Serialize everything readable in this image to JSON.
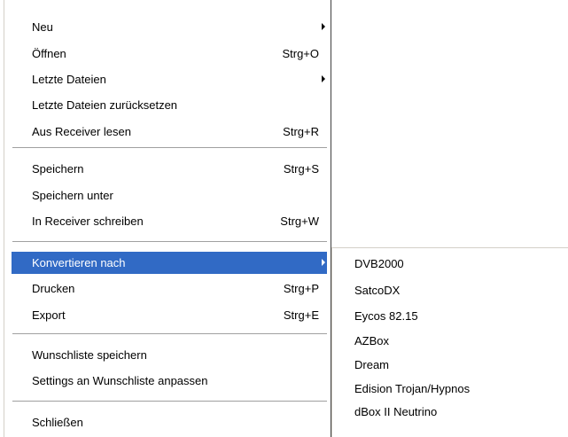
{
  "file_menu": {
    "items": [
      {
        "label": "Neu",
        "shortcut": "",
        "submenu": true
      },
      {
        "label": "Öffnen",
        "shortcut": "Strg+O",
        "submenu": false
      },
      {
        "label": "Letzte Dateien",
        "shortcut": "",
        "submenu": true
      },
      {
        "label": "Letzte Dateien zurücksetzen",
        "shortcut": "",
        "submenu": false
      },
      {
        "label": "Aus Receiver lesen",
        "shortcut": "Strg+R",
        "submenu": false
      },
      {
        "label": "Speichern",
        "shortcut": "Strg+S",
        "submenu": false
      },
      {
        "label": "Speichern unter",
        "shortcut": "",
        "submenu": false
      },
      {
        "label": "In Receiver schreiben",
        "shortcut": "Strg+W",
        "submenu": false
      },
      {
        "label": "Konvertieren nach",
        "shortcut": "",
        "submenu": true,
        "highlighted": true
      },
      {
        "label": "Drucken",
        "shortcut": "Strg+P",
        "submenu": false
      },
      {
        "label": "Export",
        "shortcut": "Strg+E",
        "submenu": false
      },
      {
        "label": "Wunschliste speichern",
        "shortcut": "",
        "submenu": false
      },
      {
        "label": "Settings an Wunschliste anpassen",
        "shortcut": "",
        "submenu": false
      },
      {
        "label": "Schließen",
        "shortcut": "",
        "submenu": false
      }
    ]
  },
  "convert_submenu": {
    "items": [
      {
        "label": "DVB2000"
      },
      {
        "label": "SatcoDX"
      },
      {
        "label": "Eycos 82.15"
      },
      {
        "label": "AZBox"
      },
      {
        "label": "Dream"
      },
      {
        "label": "Edision Trojan/Hypnos"
      },
      {
        "label": "dBox II Neutrino"
      }
    ]
  },
  "colors": {
    "highlight": "#316ac5",
    "menu_bg": "#ffffff",
    "separator": "#a0a0a0"
  },
  "icons": {
    "submenu_arrow": "submenu-arrow-icon"
  }
}
